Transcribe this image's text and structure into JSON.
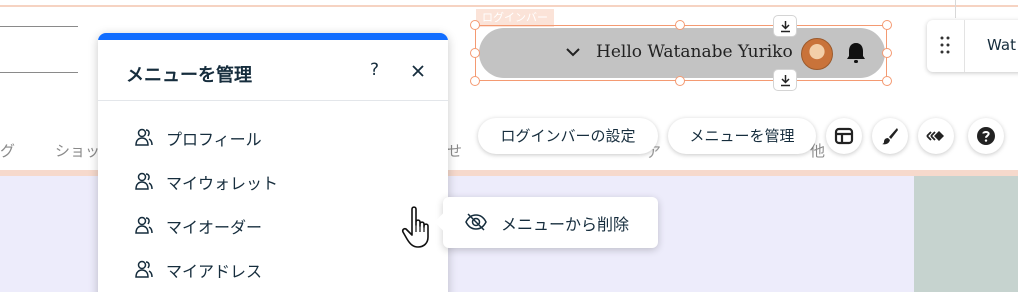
{
  "site": {
    "nav_left": "グ",
    "nav_shop": "ショッ",
    "nav_mid": "せ",
    "nav_right": "他"
  },
  "login_bar": {
    "tag_label": "ログインバー",
    "greeting": "Hello Watanabe Yuriko",
    "icons": [
      "chevron-down-icon",
      "avatar",
      "bell-icon",
      "download-icon"
    ]
  },
  "side_panel": {
    "label": "Wat"
  },
  "toolbar": {
    "login_bar_settings": "ログインバーの設定",
    "manage_menu": "メニューを管理",
    "peek_text": "ア",
    "icons": [
      "layout-icon",
      "design-brush-icon",
      "animation-icon",
      "help-icon"
    ]
  },
  "manage_menu_panel": {
    "title": "メニューを管理",
    "help": "?",
    "items": [
      {
        "label": "プロフィール",
        "icon": "member-icon"
      },
      {
        "label": "マイウォレット",
        "icon": "member-icon"
      },
      {
        "label": "マイオーダー",
        "icon": "member-icon"
      },
      {
        "label": "マイアドレス",
        "icon": "member-icon"
      }
    ]
  },
  "popover": {
    "hide_label": "メニューから削除",
    "icon": "eye-off-icon"
  },
  "colors": {
    "accent": "#116dff",
    "selection": "#f49a72",
    "pill": "#c3c3c3",
    "text": "#162d3d",
    "strip_bg": "#edecfb"
  }
}
